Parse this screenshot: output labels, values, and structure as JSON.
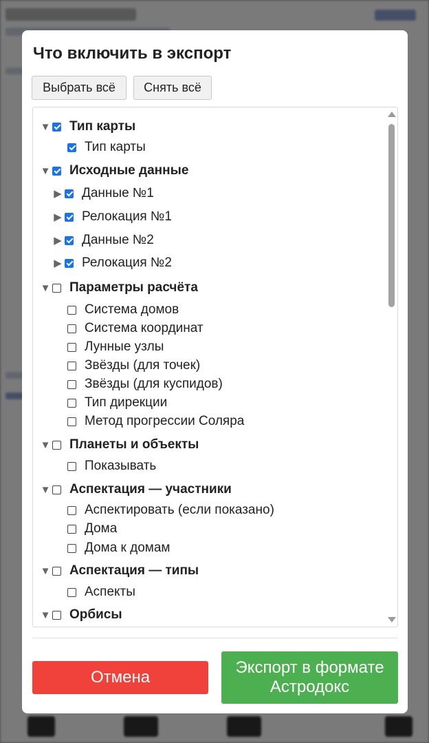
{
  "dialog": {
    "title": "Что включить в экспорт",
    "select_all_label": "Выбрать всё",
    "deselect_all_label": "Снять всё",
    "cancel_label": "Отмена",
    "export_label": "Экспорт в формате Астродокс"
  },
  "tree": {
    "groups": [
      {
        "label": "Тип карты",
        "expanded": true,
        "checked": true,
        "items": [
          {
            "label": "Тип карты",
            "checked": true,
            "expandable": false
          }
        ]
      },
      {
        "label": "Исходные данные",
        "expanded": true,
        "checked": true,
        "items": [
          {
            "label": "Данные №1",
            "checked": true,
            "expandable": true
          },
          {
            "label": "Релокация №1",
            "checked": true,
            "expandable": true
          },
          {
            "label": "Данные №2",
            "checked": true,
            "expandable": true
          },
          {
            "label": "Релокация №2",
            "checked": true,
            "expandable": true
          }
        ]
      },
      {
        "label": "Параметры расчёта",
        "expanded": true,
        "checked": false,
        "items": [
          {
            "label": "Система домов",
            "checked": false,
            "expandable": false
          },
          {
            "label": "Система координат",
            "checked": false,
            "expandable": false
          },
          {
            "label": "Лунные узлы",
            "checked": false,
            "expandable": false
          },
          {
            "label": "Звёзды (для точек)",
            "checked": false,
            "expandable": false
          },
          {
            "label": "Звёзды (для куспидов)",
            "checked": false,
            "expandable": false
          },
          {
            "label": "Тип дирекции",
            "checked": false,
            "expandable": false
          },
          {
            "label": "Метод прогрессии Соляра",
            "checked": false,
            "expandable": false
          }
        ]
      },
      {
        "label": "Планеты и объекты",
        "expanded": true,
        "checked": false,
        "items": [
          {
            "label": "Показывать",
            "checked": false,
            "expandable": false
          }
        ]
      },
      {
        "label": "Аспектация — участники",
        "expanded": true,
        "checked": false,
        "items": [
          {
            "label": "Аспектировать (если показано)",
            "checked": false,
            "expandable": false
          },
          {
            "label": "Дома",
            "checked": false,
            "expandable": false
          },
          {
            "label": "Дома к домам",
            "checked": false,
            "expandable": false
          }
        ]
      },
      {
        "label": "Аспектация — типы",
        "expanded": true,
        "checked": false,
        "items": [
          {
            "label": "Аспекты",
            "checked": false,
            "expandable": false
          }
        ]
      },
      {
        "label": "Орбисы",
        "expanded": true,
        "checked": false,
        "items": []
      }
    ]
  },
  "colors": {
    "checkbox_checked": "#1a73e8",
    "cancel_button": "#f0413a",
    "export_button": "#4caf50"
  }
}
